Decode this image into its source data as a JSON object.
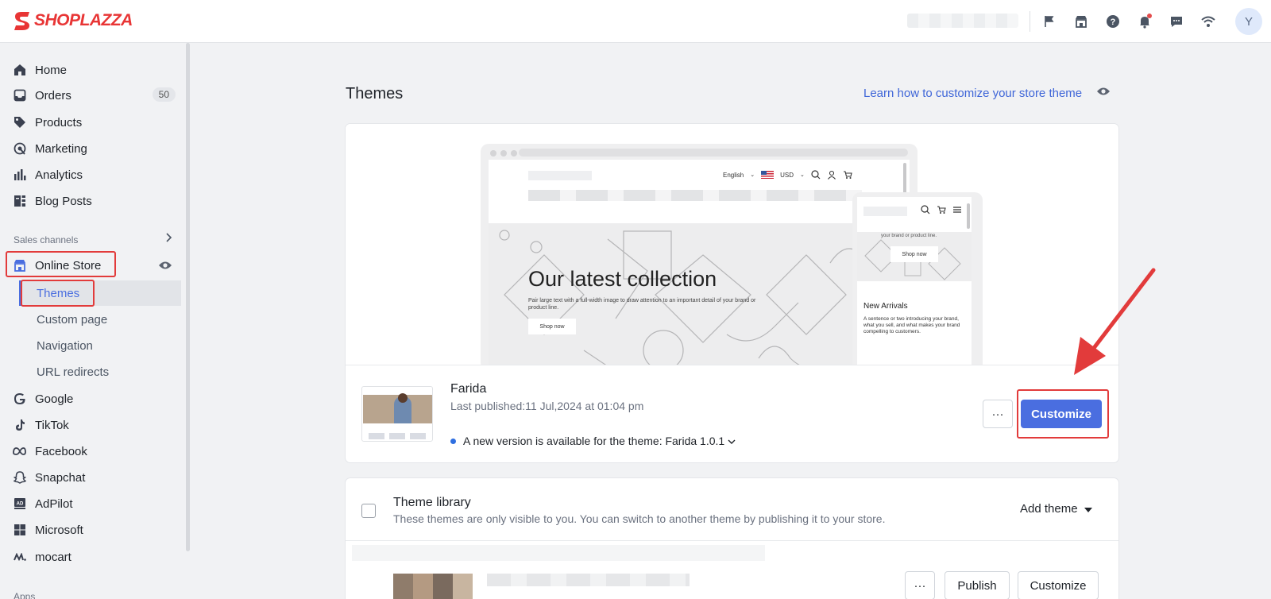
{
  "brand": {
    "name": "SHOPLAZZA",
    "color": "#e83535"
  },
  "topbar": {
    "icons": [
      "flag-icon",
      "store-icon",
      "help-icon",
      "bell-icon",
      "chat-icon",
      "wifi-icon"
    ],
    "avatar_initial": "Y"
  },
  "sidebar": {
    "items": [
      {
        "label": "Home",
        "icon": "home-icon"
      },
      {
        "label": "Orders",
        "icon": "inbox-icon",
        "badge": "50"
      },
      {
        "label": "Products",
        "icon": "tag-icon"
      },
      {
        "label": "Marketing",
        "icon": "marketing-icon"
      },
      {
        "label": "Analytics",
        "icon": "bar-chart-icon"
      },
      {
        "label": "Blog Posts",
        "icon": "blog-icon"
      }
    ],
    "sales_channels_label": "Sales channels",
    "online_store": "Online Store",
    "online_store_sub": [
      "Themes",
      "Custom page",
      "Navigation",
      "URL redirects"
    ],
    "channels": [
      {
        "label": "Google",
        "icon": "google-icon"
      },
      {
        "label": "TikTok",
        "icon": "tiktok-icon"
      },
      {
        "label": "Facebook",
        "icon": "meta-icon"
      },
      {
        "label": "Snapchat",
        "icon": "snapchat-icon"
      },
      {
        "label": "AdPilot",
        "icon": "ad-icon"
      },
      {
        "label": "Microsoft",
        "icon": "microsoft-icon"
      },
      {
        "label": "mocart",
        "icon": "mocart-icon"
      }
    ],
    "apps_label": "Apps"
  },
  "main": {
    "title": "Themes",
    "learn_link": "Learn how to customize your store theme",
    "preview": {
      "lang": "English",
      "currency": "USD",
      "hero_title": "Our latest collection",
      "hero_sub": "Pair large text with a full-width image to draw attention to an important detail of your brand or product line.",
      "hero_button": "Shop now",
      "mobile_hero_text": "your brand or product line.",
      "mobile_button": "Shop now",
      "mobile_heading": "New Arrivals",
      "mobile_desc": "A sentence or two introducing your brand, what you sell, and what makes your brand compelling to customers."
    },
    "current_theme": {
      "name": "Farida",
      "published": "Last published:11 Jul,2024 at 01:04 pm",
      "update_notice": "A new version is available for the theme: Farida 1.0.1",
      "more_label": "···",
      "customize_label": "Customize"
    },
    "library": {
      "title": "Theme library",
      "description": "These themes are only visible to you. You can switch to another theme by publishing it to your store.",
      "add_theme": "Add theme",
      "more_label": "···",
      "publish_label": "Publish",
      "customize_label": "Customize"
    }
  },
  "colors": {
    "primary": "#4a6ee0",
    "highlight": "#e23b3b",
    "link": "#3f66d8"
  }
}
